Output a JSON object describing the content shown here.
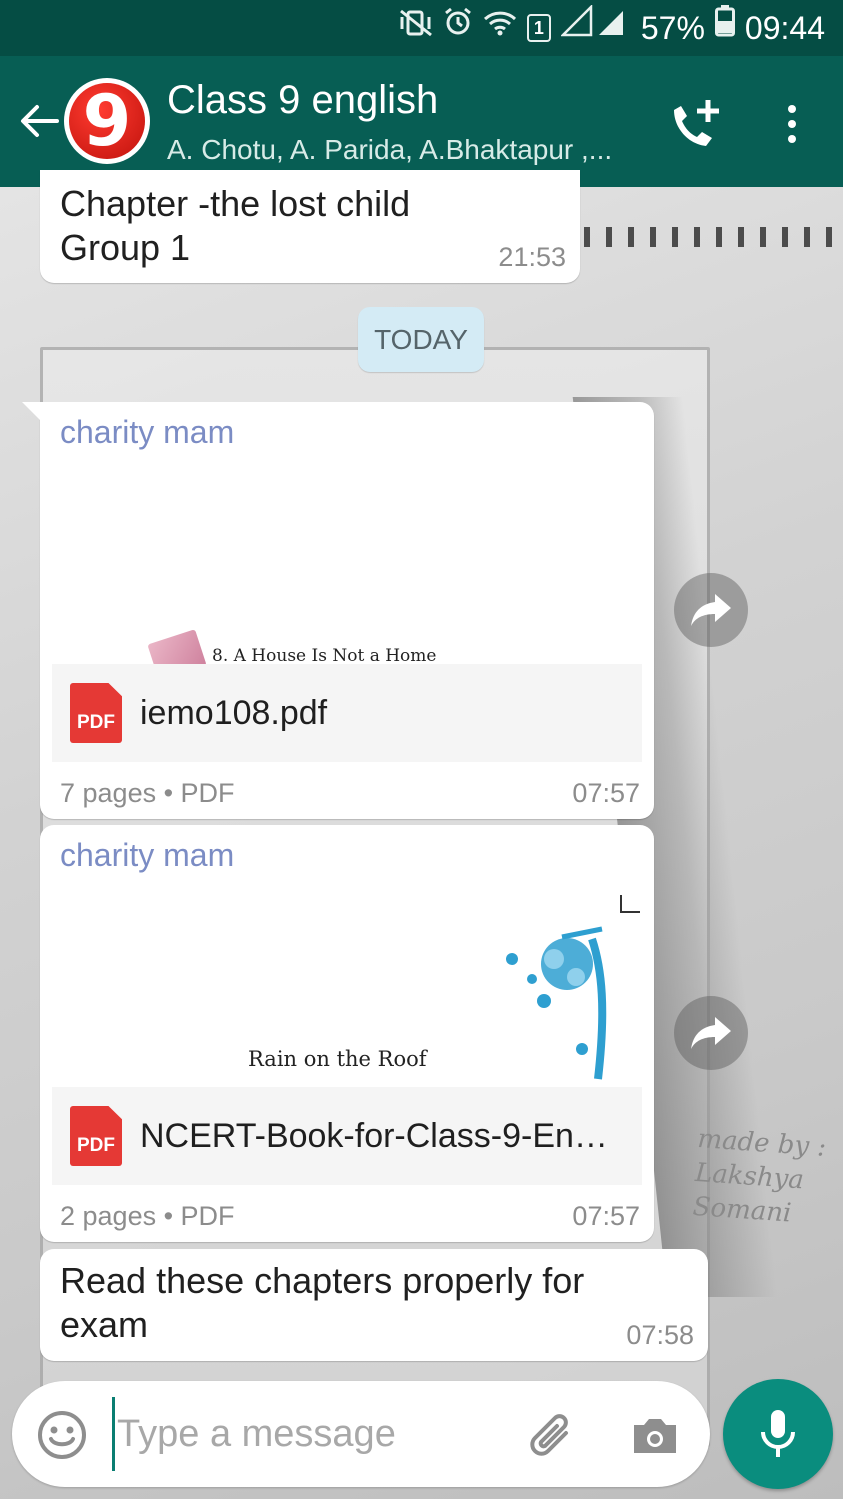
{
  "status_bar": {
    "battery": "57%",
    "time": "09:44",
    "sim_badge": "1",
    "icons": [
      "vibrate-mute-icon",
      "alarm-icon",
      "wifi-icon",
      "signal-icon",
      "battery-icon"
    ]
  },
  "header": {
    "title": "Class 9 english",
    "subtitle": "A. Chotu, A. Parida, A.Bhaktapur ,...",
    "avatar_text": "9",
    "colors": {
      "status_bar": "#054d44",
      "toolbar": "#075e54"
    }
  },
  "messages": {
    "prev": {
      "text_line1": "Chapter -the lost child",
      "text_line2": "Group 1",
      "time": "21:53"
    },
    "date_divider": "TODAY",
    "doc1": {
      "sender": "charity mam",
      "preview_text": "8. A House Is Not a Home",
      "file_badge": "PDF",
      "file_name": "iemo108.pdf",
      "meta": "7 pages • PDF",
      "time": "07:57"
    },
    "doc2": {
      "sender": "charity mam",
      "preview_text": "Rain on the Roof",
      "file_badge": "PDF",
      "file_name": "NCERT-Book-for-Class-9-Eng...",
      "meta": "2 pages • PDF",
      "time": "07:57"
    },
    "last": {
      "text": "Read these chapters properly for exam",
      "time": "07:58"
    }
  },
  "wallpaper": {
    "signature": "made by : Lakshya Somani"
  },
  "composer": {
    "placeholder": "Type a message",
    "value": ""
  },
  "colors": {
    "accent": "#0a8d7e",
    "sender_name": "#7b8cc4",
    "date_chip": "#d4ebf5",
    "pdf_red": "#e53935"
  }
}
